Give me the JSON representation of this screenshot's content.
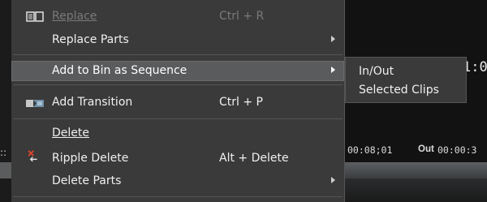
{
  "background": {
    "timecode_partial": "1:0",
    "in_timecode": "00:08;01",
    "left_dashes": "::",
    "out_label": "Out",
    "out_timecode": "00:00:3"
  },
  "menu": {
    "items": [
      {
        "label": "Replace",
        "shortcut": "Ctrl + R",
        "disabled": true,
        "icon": "replace-icon"
      },
      {
        "label": "Replace Parts",
        "submenu": true
      },
      {
        "label": "Add to Bin as Sequence",
        "submenu": true,
        "highlighted": true
      },
      {
        "label": "Add Transition",
        "shortcut": "Ctrl + P",
        "icon": "transition-icon"
      },
      {
        "label": "Delete"
      },
      {
        "label": "Ripple Delete",
        "shortcut": "Alt + Delete",
        "icon": "ripple-delete-icon"
      },
      {
        "label": "Delete Parts",
        "submenu": true
      }
    ]
  },
  "submenu": {
    "items": [
      {
        "label": "In/Out"
      },
      {
        "label": "Selected Clips"
      }
    ]
  },
  "colors": {
    "menu_bg": "#3a3a3a",
    "highlight_bg": "#5a5b5d",
    "disabled_text": "#7a7a7a",
    "delete_x": "#e0442c"
  }
}
